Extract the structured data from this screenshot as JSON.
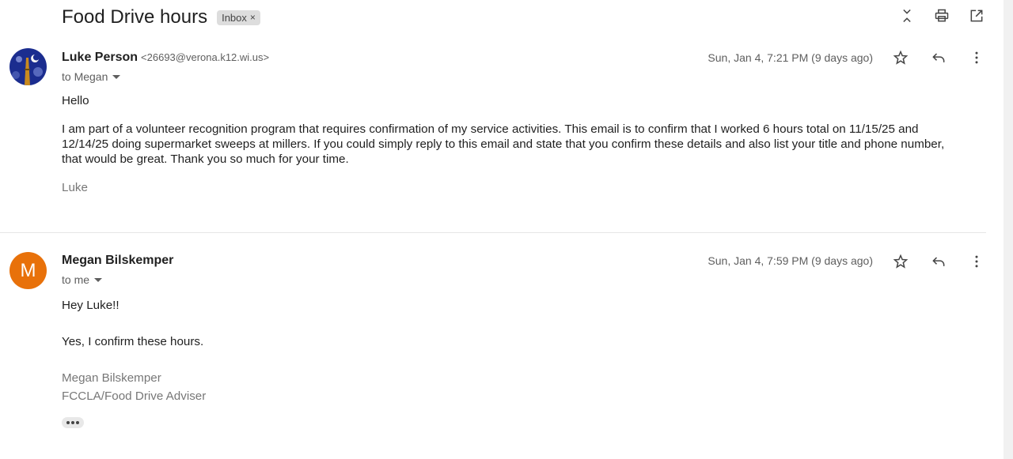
{
  "thread": {
    "subject": "Food Drive hours",
    "label": "Inbox",
    "label_remove": "×"
  },
  "messages": [
    {
      "sender_name": "Luke Person",
      "sender_email": "<26693@verona.k12.wi.us>",
      "recipient": "to Megan",
      "date": "Sun, Jan 4, 7:21 PM (9 days ago)",
      "greeting": "Hello",
      "body": "I am part of a volunteer recognition program that requires confirmation of my service activities. This email is to confirm that I worked 6 hours total on 11/15/25 and 12/14/25 doing supermarket sweeps at millers. If you could simply reply to this email and state that you confirm these details and also list your title and phone number, that would be great. Thank you so much for your time.",
      "signature": "Luke"
    },
    {
      "sender_name": "Megan Bilskemper",
      "avatar_letter": "M",
      "recipient": "to me",
      "date": "Sun, Jan 4, 7:59 PM (9 days ago)",
      "greeting": "Hey Luke!!",
      "body": "Yes, I confirm these hours.",
      "signature_line1": "Megan Bilskemper",
      "signature_line2": "FCCLA/Food Drive Adviser"
    }
  ],
  "icons": {
    "collapse": "collapse-icon",
    "print": "print-icon",
    "open_new_window": "open-in-new-window-icon",
    "star": "star-icon",
    "reply": "reply-icon",
    "more": "more-vert-icon"
  },
  "colors": {
    "avatar_m": "#e8710a"
  }
}
